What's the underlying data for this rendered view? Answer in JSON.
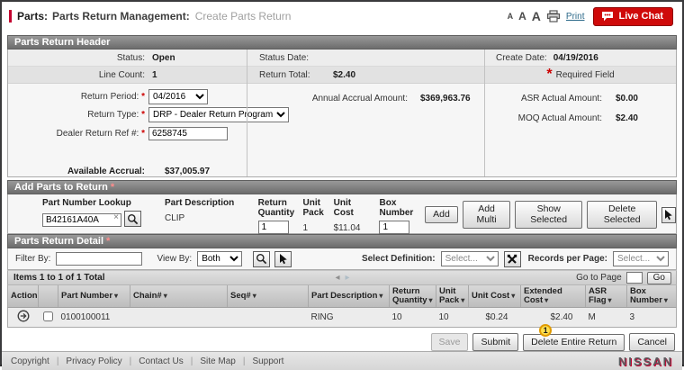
{
  "topbar": {
    "breadcrumb_parts": "Parts:",
    "breadcrumb_section": "Parts Return Management:",
    "breadcrumb_page": "Create Parts Return",
    "font_size_a": "A",
    "print_label": "Print",
    "live_chat_label": "Live Chat"
  },
  "header": {
    "title": "Parts Return Header",
    "status_label": "Status:",
    "status_value": "Open",
    "line_count_label": "Line Count:",
    "line_count_value": "1",
    "return_period_label": "Return Period:",
    "return_period_value": "04/2016",
    "return_type_label": "Return Type:",
    "return_type_value": "DRP - Dealer Return Program",
    "dealer_ref_label": "Dealer Return Ref #:",
    "dealer_ref_value": "6258745",
    "available_accrual_label": "Available Accrual:",
    "available_accrual_value": "$37,005.97",
    "status_date_label": "Status Date:",
    "status_date_value": "",
    "return_total_label": "Return Total:",
    "return_total_value": "$2.40",
    "annual_accrual_label": "Annual Accrual Amount:",
    "annual_accrual_value": "$369,963.76",
    "create_date_label": "Create Date:",
    "create_date_value": "04/19/2016",
    "required_star": "*",
    "required_field_note": "Required Field",
    "asr_label": "ASR Actual Amount:",
    "asr_value": "$0.00",
    "moq_label": "MOQ Actual Amount:",
    "moq_value": "$2.40"
  },
  "add_parts": {
    "title": "Add Parts to Return",
    "col_part_number": "Part Number Lookup",
    "col_part_description": "Part Description",
    "col_return_quantity": "Return Quantity",
    "col_unit_pack": "Unit Pack",
    "col_unit_cost": "Unit Cost",
    "col_box_number": "Box Number",
    "part_number_value": "B42161A40A",
    "clear_x": "×",
    "part_description_value": "CLIP",
    "return_quantity_value": "1",
    "unit_pack_value": "1",
    "unit_cost_value": "$11.04",
    "box_number_value": "1",
    "buttons": [
      "Add",
      "Add Multi",
      "Show Selected",
      "Delete Selected"
    ]
  },
  "detail": {
    "title": "Parts Return Detail",
    "filter_by_label": "Filter By:",
    "filter_value": "",
    "view_by_label": "View By:",
    "view_by_value": "Both",
    "select_definition_label": "Select Definition:",
    "select_definition_value": "Select...",
    "records_per_page_label": "Records per Page:",
    "records_per_page_value": "Select...",
    "items_summary": "Items 1 to 1 of 1 Total",
    "go_to_page_label": "Go to Page",
    "go_button": "Go",
    "table": {
      "headers": {
        "action": "Action",
        "part_number": "Part Number",
        "chain": "Chain#",
        "seq": "Seq#",
        "part_description": "Part Description",
        "return_quantity": "Return Quantity",
        "unit_pack": "Unit Pack",
        "unit_cost": "Unit Cost",
        "extended_cost": "Extended Cost",
        "asr_flag": "ASR Flag",
        "box_number": "Box Number"
      },
      "row": {
        "part_number": "0100100011",
        "chain": "",
        "seq": "",
        "part_description": "RING",
        "return_quantity": "10",
        "unit_pack": "10",
        "unit_cost": "$0.24",
        "extended_cost": "$2.40",
        "asr_flag": "M",
        "box_number": "3"
      }
    }
  },
  "actions": {
    "save": "Save",
    "submit": "Submit",
    "delete_entire": "Delete Entire Return",
    "cancel": "Cancel",
    "annotation": "1"
  },
  "footer": {
    "links": [
      "Copyright",
      "Privacy Policy",
      "Contact Us",
      "Site Map",
      "Support"
    ],
    "brand": "NISSAN"
  }
}
